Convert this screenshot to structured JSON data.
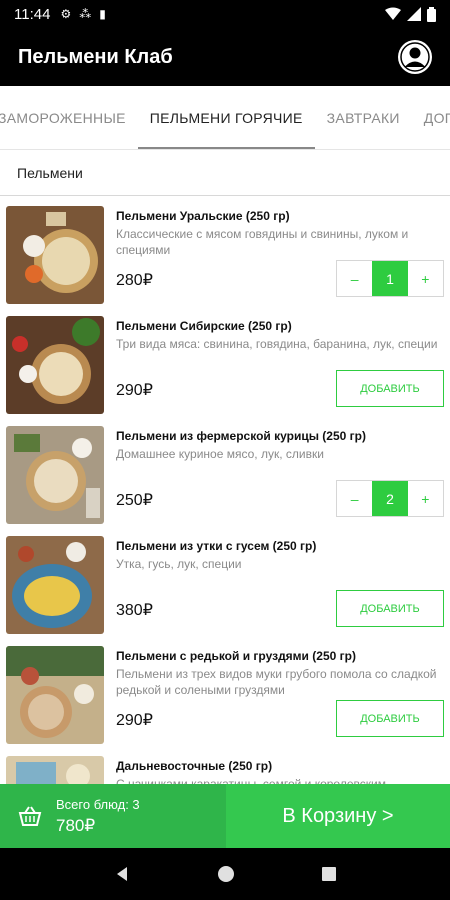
{
  "status": {
    "time": "11:44"
  },
  "app": {
    "title": "Пельмени Клаб"
  },
  "tabs": [
    {
      "label": "ЗАМОРОЖЕННЫЕ",
      "active": false
    },
    {
      "label": "ПЕЛЬМЕНИ ГОРЯЧИЕ",
      "active": true
    },
    {
      "label": "ЗАВТРАКИ",
      "active": false
    },
    {
      "label": "ДОП",
      "active": false
    }
  ],
  "section": {
    "title": "Пельмени"
  },
  "items": [
    {
      "name": "Пельмени Уральские (250 гр)",
      "desc": "Классические с мясом говядины и свинины, луком и специями",
      "price": "280₽",
      "qty": "1",
      "minus": "–",
      "plus": "+",
      "bg": "#7a5637",
      "plate": "#c9a060"
    },
    {
      "name": "Пельмени Сибирские (250 гр)",
      "desc": "Три вида мяса: свинина, говядина, баранина, лук, специи",
      "price": "290₽",
      "button": "ДОБАВИТЬ",
      "bg": "#5c3d28",
      "plate": "#b98a50"
    },
    {
      "name": "Пельмени из фермерской курицы (250 гр)",
      "desc": "Домашнее куриное мясо, лук, сливки",
      "price": "250₽",
      "qty": "2",
      "minus": "–",
      "plus": "+",
      "bg": "#a89a84",
      "plate": "#c7a16a"
    },
    {
      "name": "Пельмени из утки с гусем (250 гр)",
      "desc": "Утка, гусь, лук, специи",
      "price": "380₽",
      "button": "ДОБАВИТЬ",
      "bg": "#8e6a49",
      "plate": "#3f7fa8"
    },
    {
      "name": "Пельмени с редькой и груздями (250 гр)",
      "desc": "Пельмени из трех видов муки грубого помола со сладкой редькой и солеными груздями",
      "price": "290₽",
      "button": "ДОБАВИТЬ",
      "bg": "#c4b08a",
      "plate": "#c79a6a"
    },
    {
      "name": "Дальневосточные (250 гр)",
      "desc": "С начинками каракатицы, семгой и королевским",
      "price": "",
      "button": "",
      "bg": "#d8c9a8",
      "plate": "#e0c090"
    }
  ],
  "footer": {
    "count_label": "Всего блюд: 3",
    "total": "780₽",
    "cart_button": "В Корзину >"
  },
  "colors": {
    "accent": "#34c84f",
    "appbar": "#000000"
  }
}
